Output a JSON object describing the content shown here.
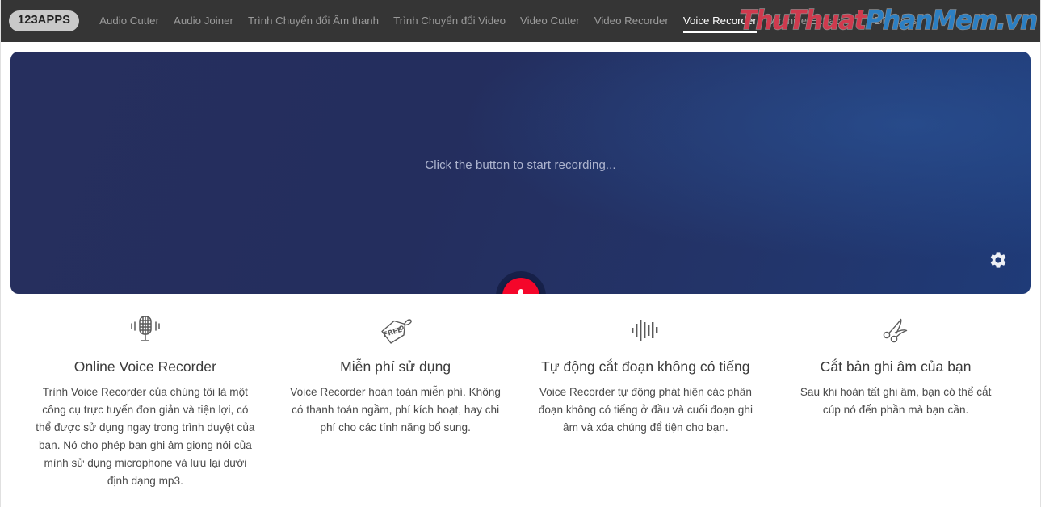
{
  "navbar": {
    "logo": "123APPS",
    "items": [
      {
        "label": "Audio Cutter",
        "active": false
      },
      {
        "label": "Audio Joiner",
        "active": false
      },
      {
        "label": "Trình Chuyển đổi Âm thanh",
        "active": false
      },
      {
        "label": "Trình Chuyển đổi Video",
        "active": false
      },
      {
        "label": "Video Cutter",
        "active": false
      },
      {
        "label": "Video Recorder",
        "active": false
      },
      {
        "label": "Voice Recorder",
        "active": true
      },
      {
        "label": "Archive Extractor",
        "active": false
      },
      {
        "label": "PDF Tools",
        "active": false
      }
    ],
    "watermark": {
      "part1": "ThuThuat",
      "part2": "PhanMem.vn",
      "color1": "#cf3a4e",
      "color2": "#2c7fc2"
    },
    "background_color": "#353535"
  },
  "hero": {
    "prompt": "Click the button to start recording...",
    "record_button_icon": "microphone-icon",
    "record_button_color": "#f5062a",
    "settings_icon": "gear-icon",
    "gradient_start": "#262f5e",
    "gradient_end": "#1f3b78"
  },
  "features": [
    {
      "icon": "retro-microphone-icon",
      "title": "Online Voice Recorder",
      "description": "Trình Voice Recorder của chúng tôi là một công cụ trực tuyến đơn giản và tiện lợi, có thể được sử dụng ngay trong trình duyệt của bạn. Nó cho phép bạn ghi âm giọng nói của mình sử dụng microphone và lưu lại dưới định dạng mp3."
    },
    {
      "icon": "free-price-tag-icon",
      "title": "Miễn phí sử dụng",
      "description": "Voice Recorder hoàn toàn miễn phí. Không có thanh toán ngầm, phí kích hoạt, hay chi phí cho các tính năng bổ sung."
    },
    {
      "icon": "audio-waveform-icon",
      "title": "Tự động cắt đoạn không có tiếng",
      "description": "Voice Recorder tự động phát hiện các phân đoạn không có tiếng ở đầu và cuối đoạn ghi âm và xóa chúng để tiện cho bạn."
    },
    {
      "icon": "scissors-icon",
      "title": "Cắt bản ghi âm của bạn",
      "description": "Sau khi hoàn tất ghi âm, bạn có thể cắt cúp nó đến phần mà bạn cần."
    }
  ]
}
